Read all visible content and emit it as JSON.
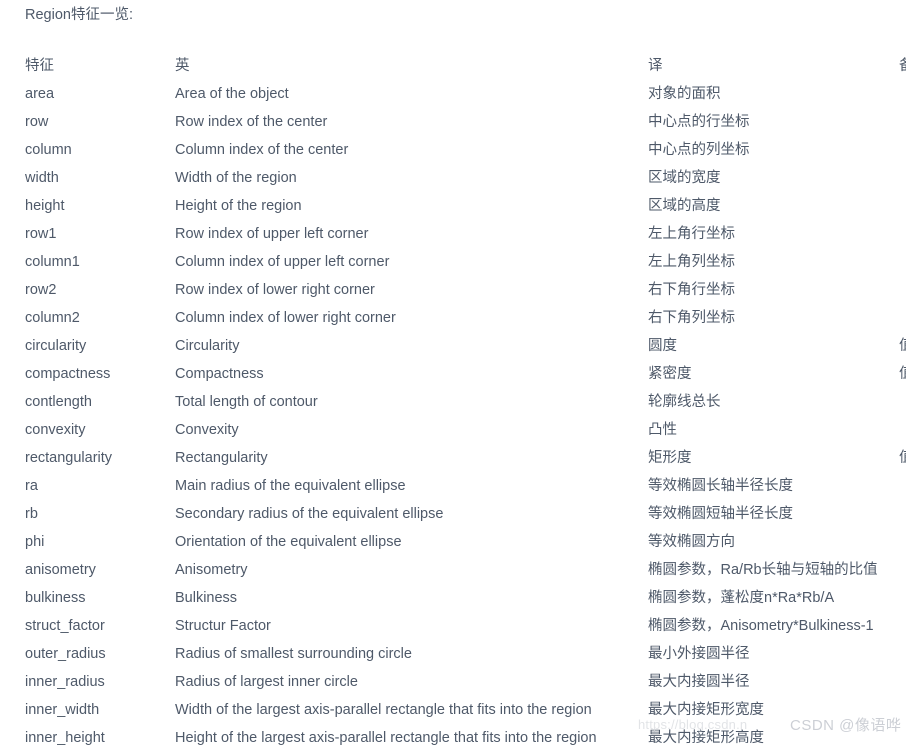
{
  "page": {
    "title": "Region特征一览:",
    "background": "#ffffff",
    "text_color": "#4e5969",
    "watermark_color": "#c9ccd2"
  },
  "table": {
    "headers": {
      "name": "特征",
      "english": "英",
      "chinese": "译",
      "extra": "备"
    },
    "rows": [
      {
        "name": "area",
        "english": "Area of the object",
        "chinese": "对象的面积",
        "extra": ""
      },
      {
        "name": "row",
        "english": "Row index of the center",
        "chinese": "中心点的行坐标",
        "extra": ""
      },
      {
        "name": "column",
        "english": "Column index of the center",
        "chinese": "中心点的列坐标",
        "extra": ""
      },
      {
        "name": "width",
        "english": "Width of the region",
        "chinese": "区域的宽度",
        "extra": ""
      },
      {
        "name": "height",
        "english": "Height of the region",
        "chinese": "区域的高度",
        "extra": ""
      },
      {
        "name": "row1",
        "english": "Row index of upper left corner",
        "chinese": "左上角行坐标",
        "extra": ""
      },
      {
        "name": "column1",
        "english": "Column index of upper left corner",
        "chinese": "左上角列坐标",
        "extra": ""
      },
      {
        "name": "row2",
        "english": "Row index of lower right corner",
        "chinese": "右下角行坐标",
        "extra": ""
      },
      {
        "name": "column2",
        "english": "Column index of lower right corner",
        "chinese": "右下角列坐标",
        "extra": ""
      },
      {
        "name": "circularity",
        "english": "Circularity",
        "chinese": "圆度",
        "extra": "值"
      },
      {
        "name": "compactness",
        "english": "Compactness",
        "chinese": "紧密度",
        "extra": "值"
      },
      {
        "name": "contlength",
        "english": "Total length of contour",
        "chinese": "轮廓线总长",
        "extra": ""
      },
      {
        "name": "convexity",
        "english": "Convexity",
        "chinese": "凸性",
        "extra": ""
      },
      {
        "name": "rectangularity",
        "english": "Rectangularity",
        "chinese": "矩形度",
        "extra": "值"
      },
      {
        "name": "ra",
        "english": "Main radius of the equivalent ellipse",
        "chinese": "等效椭圆长轴半径长度",
        "extra": ""
      },
      {
        "name": "rb",
        "english": "Secondary radius of the equivalent ellipse",
        "chinese": "等效椭圆短轴半径长度",
        "extra": ""
      },
      {
        "name": "phi",
        "english": "Orientation of the equivalent ellipse",
        "chinese": "等效椭圆方向",
        "extra": ""
      },
      {
        "name": "anisometry",
        "english": "Anisometry",
        "chinese": "椭圆参数，Ra/Rb长轴与短轴的比值",
        "extra": ""
      },
      {
        "name": "bulkiness",
        "english": "Bulkiness",
        "chinese": "椭圆参数，蓬松度n*Ra*Rb/A",
        "extra": ""
      },
      {
        "name": "struct_factor",
        "english": "Structur Factor",
        "chinese": "椭圆参数，Anisometry*Bulkiness-1",
        "extra": ""
      },
      {
        "name": "outer_radius",
        "english": "Radius of smallest surrounding circle",
        "chinese": "最小外接圆半径",
        "extra": ""
      },
      {
        "name": "inner_radius",
        "english": "Radius of largest inner circle",
        "chinese": "最大内接圆半径",
        "extra": ""
      },
      {
        "name": "inner_width",
        "english": "Width of the largest axis-parallel rectangle that fits into the region",
        "chinese": "最大内接矩形宽度",
        "extra": ""
      },
      {
        "name": "inner_height",
        "english": "Height of the largest axis-parallel rectangle that fits into the region",
        "chinese": "最大内接矩形高度",
        "extra": ""
      }
    ]
  },
  "watermark": {
    "url": "https://blog.csdn.n",
    "brand": "CSDN @像语哗"
  }
}
